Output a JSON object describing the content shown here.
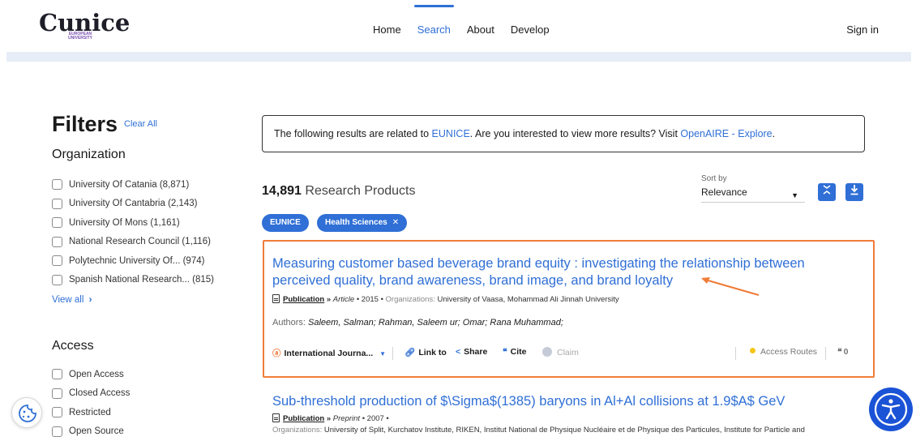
{
  "header": {
    "logo_text": "Cunice",
    "logo_subtext": "EUROPEAN UNIVERSITY",
    "nav": [
      {
        "label": "Home",
        "active": false
      },
      {
        "label": "Search",
        "active": true
      },
      {
        "label": "About",
        "active": false
      },
      {
        "label": "Develop",
        "active": false
      }
    ],
    "sign_in": "Sign in",
    "accent_color": "#2f6fd6"
  },
  "filters": {
    "title": "Filters",
    "clear_all": "Clear All",
    "organization": {
      "title": "Organization",
      "items": [
        "University Of Catania (8,871)",
        "University Of Cantabria (2,143)",
        "University Of Mons (1,161)",
        "National Research Council (1,116)",
        "Polytechnic University Of... (974)",
        "Spanish National Research... (815)"
      ],
      "view_all": "View all"
    },
    "access": {
      "title": "Access",
      "items": [
        "Open Access",
        "Closed Access",
        "Restricted",
        "Open Source"
      ]
    }
  },
  "notice": {
    "prefix": "The following results are related to ",
    "link1": "EUNICE",
    "middle": ". Are you interested to view more results? Visit ",
    "link2": "OpenAIRE - Explore",
    "suffix": "."
  },
  "results": {
    "count": "14,891",
    "count_label": "Research Products",
    "sort_label": "Sort by",
    "sort_value": "Relevance",
    "chips": [
      "EUNICE",
      "Health Sciences"
    ],
    "items": [
      {
        "title_line1": "Measuring customer based beverage brand equity : investigating the relationship between",
        "title_line2": "perceived quality, brand awareness, brand image, and brand loyalty",
        "type": "Publication",
        "subtype": "Article",
        "year": "2015",
        "org_label": "Organizations:",
        "orgs": "University of Vaasa, Mohammad Ali Jinnah University",
        "authors_label": "Authors:",
        "authors": "Saleem, Salman; Rahman, Saleem ur; Omar; Rana Muhammad;",
        "source": "International Journa...",
        "link_to": "Link to",
        "share": "Share",
        "cite": "Cite",
        "claim": "Claim",
        "access_routes": "Access Routes",
        "citations": "0"
      },
      {
        "title_line1": "Sub-threshold production of $\\Sigma$(1385) baryons in Al+Al collisions at 1.9$A$ GeV",
        "type": "Publication",
        "subtype": "Preprint",
        "year": "2007",
        "org_label": "Organizations:",
        "orgs": "University of Split, Kurchatov Institute, RIKEN, Institut National de Physique Nucléaire et de Physique des Particules, Institute for Particle and"
      }
    ]
  },
  "icons": {
    "cookie": "cookie-icon",
    "accessibility": "accessibility-icon",
    "annotation": "orange-arrow"
  }
}
